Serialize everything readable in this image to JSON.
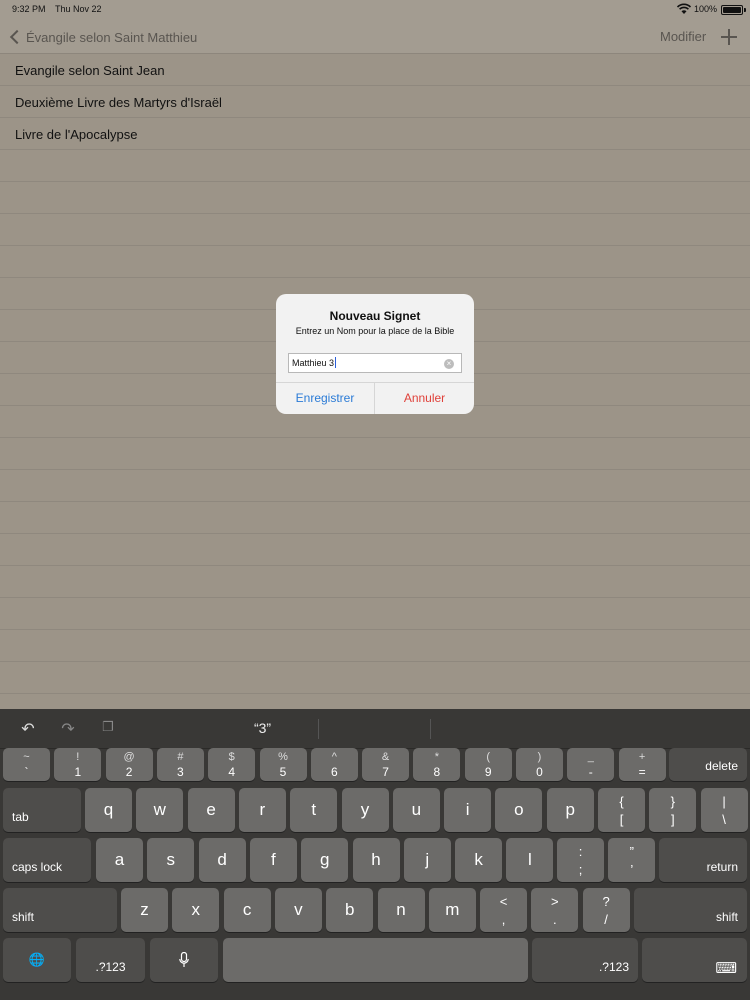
{
  "status_bar": {
    "time": "9:32 PM",
    "date": "Thu Nov 22",
    "battery": "100%"
  },
  "nav": {
    "back_label": "Évangile selon Saint Matthieu",
    "edit_label": "Modifier",
    "add_icon": "plus-icon"
  },
  "bookmarks": [
    "Evangile selon Saint Jean",
    "Deuxième Livre des Martyrs d'Israël",
    "Livre de l'Apocalypse"
  ],
  "dialog": {
    "title": "Nouveau Signet",
    "message": "Entrez un Nom pour la place de la Bible",
    "input_value": "Matthieu 3",
    "save_label": "Enregistrer",
    "cancel_label": "Annuler"
  },
  "keyboard": {
    "suggestion": "“3”",
    "row1": [
      {
        "top": "~",
        "bot": "`"
      },
      {
        "top": "!",
        "bot": "1"
      },
      {
        "top": "@",
        "bot": "2"
      },
      {
        "top": "#",
        "bot": "3"
      },
      {
        "top": "$",
        "bot": "4"
      },
      {
        "top": "%",
        "bot": "5"
      },
      {
        "top": "^",
        "bot": "6"
      },
      {
        "top": "&",
        "bot": "7"
      },
      {
        "top": "*",
        "bot": "8"
      },
      {
        "top": "(",
        "bot": "9"
      },
      {
        "top": ")",
        "bot": "0"
      },
      {
        "top": "_",
        "bot": "-"
      },
      {
        "top": "+",
        "bot": "="
      }
    ],
    "delete": "delete",
    "tab": "tab",
    "row2": [
      "q",
      "w",
      "e",
      "r",
      "t",
      "y",
      "u",
      "i",
      "o",
      "p"
    ],
    "row2_pairs": [
      {
        "top": "{",
        "bot": "["
      },
      {
        "top": "}",
        "bot": "]"
      },
      {
        "top": "|",
        "bot": "\\"
      }
    ],
    "caps_lock": "caps lock",
    "row3": [
      "a",
      "s",
      "d",
      "f",
      "g",
      "h",
      "j",
      "k",
      "l"
    ],
    "row3_pairs": [
      {
        "top": ":",
        "bot": ";"
      },
      {
        "top": "”",
        "bot": "’"
      }
    ],
    "return": "return",
    "shift": "shift",
    "row4": [
      "z",
      "x",
      "c",
      "v",
      "b",
      "n",
      "m"
    ],
    "row4_pairs": [
      {
        "top": "<",
        "bot": ","
      },
      {
        "top": ">",
        "bot": "."
      },
      {
        "top": "?",
        "bot": "/"
      }
    ],
    "numbers": ".?123"
  }
}
